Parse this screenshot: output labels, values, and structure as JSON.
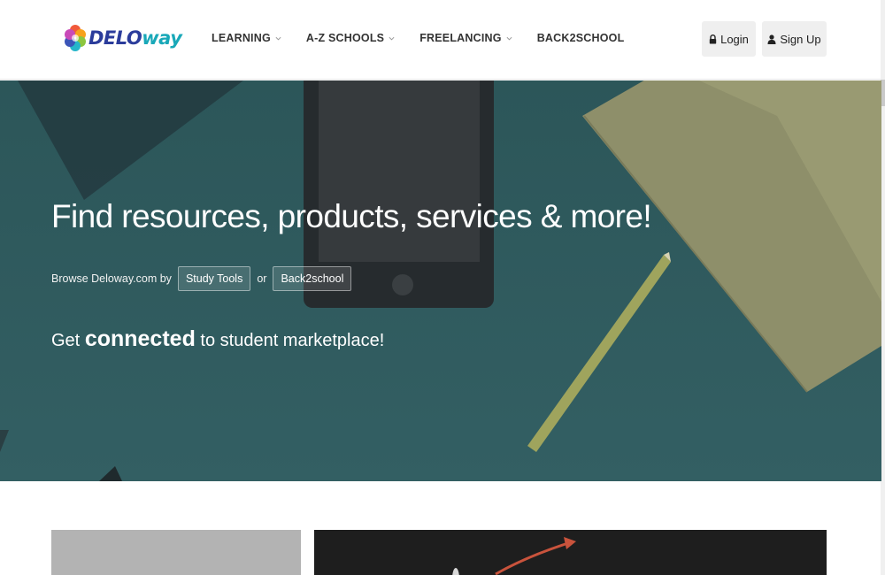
{
  "header": {
    "logo": {
      "part1": "DELO",
      "part2": "way"
    },
    "nav": [
      {
        "label": "LEARNING",
        "has_dropdown": true
      },
      {
        "label": "A-Z SCHOOLS",
        "has_dropdown": true
      },
      {
        "label": "FREELANCING",
        "has_dropdown": true
      },
      {
        "label": "BACK2SCHOOL",
        "has_dropdown": false
      }
    ],
    "login_label": "Login",
    "signup_label": "Sign Up"
  },
  "hero": {
    "title": "Find resources, products, services & more!",
    "browse_prefix": "Browse Deloway.com by",
    "browse_tag1": "Study Tools",
    "browse_or": "or",
    "browse_tag2": "Back2school",
    "tagline_pre": "Get",
    "tagline_strong": "connected",
    "tagline_post": "to student marketplace!"
  },
  "colors": {
    "hero_bg": "#2f5e62",
    "brand_blue": "#2b3c9b",
    "brand_teal": "#19a8b8"
  },
  "icons": [
    "lock-icon",
    "user-icon",
    "chevron-down-icon",
    "flower-logo-icon"
  ]
}
